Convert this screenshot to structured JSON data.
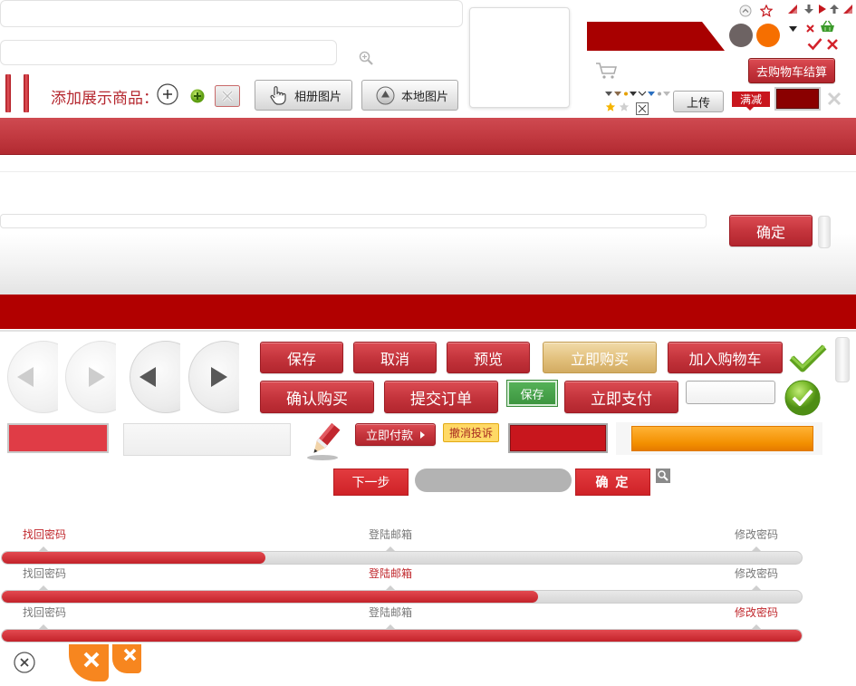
{
  "colors": {
    "primary_red": "#c8323a",
    "dark_red": "#b10000",
    "gold": "#e2c07c",
    "green": "#45a046",
    "orange": "#f39000"
  },
  "add_product": {
    "label": "添加展示商品：",
    "album_button": "相册图片",
    "local_button": "本地图片"
  },
  "cart": {
    "checkout_button": "去购物车结算"
  },
  "upload_button": "上传",
  "promo_tag": "满减",
  "confirm_button": "确定",
  "actions": {
    "save": "保存",
    "cancel": "取消",
    "preview": "预览",
    "buy_now": "立即购买",
    "add_to_cart": "加入购物车",
    "confirm_purchase": "确认购买",
    "submit_order": "提交订单",
    "save_small": "保存",
    "pay_now": "立即支付",
    "pay_immediately": "立即付款",
    "withdraw_complaint": "撤消投诉",
    "next_step": "下一步",
    "ok": "确 定"
  },
  "rating": {
    "filled_stars": 1,
    "total_stars": 2
  },
  "progress_bars": [
    {
      "steps": [
        "找回密码",
        "登陆邮箱",
        "修改密码"
      ],
      "active_step": 0,
      "progress": 0.33
    },
    {
      "steps": [
        "找回密码",
        "登陆邮箱",
        "修改密码"
      ],
      "active_step": 1,
      "progress": 0.67
    },
    {
      "steps": [
        "找回密码",
        "登陆邮箱",
        "修改密码"
      ],
      "active_step": 2,
      "progress": 1.0
    }
  ],
  "icons": [
    "zoom-in-icon",
    "circle-up-icon",
    "star-outline-icon",
    "corner-triangle-icon",
    "arrow-down-icon",
    "triangle-right-icon",
    "arrow-up-icon",
    "dropdown-triangle-icon",
    "close-icon",
    "basket-icon",
    "check-icon",
    "cart-icon",
    "star-icon",
    "hand-pointer-icon",
    "plus-circle-icon",
    "green-plus-icon",
    "delete-box-icon",
    "arrow-left-icon",
    "arrow-right-icon",
    "check-large-icon",
    "check-circle-icon",
    "pencil-icon",
    "search-icon",
    "close-circle-icon"
  ]
}
